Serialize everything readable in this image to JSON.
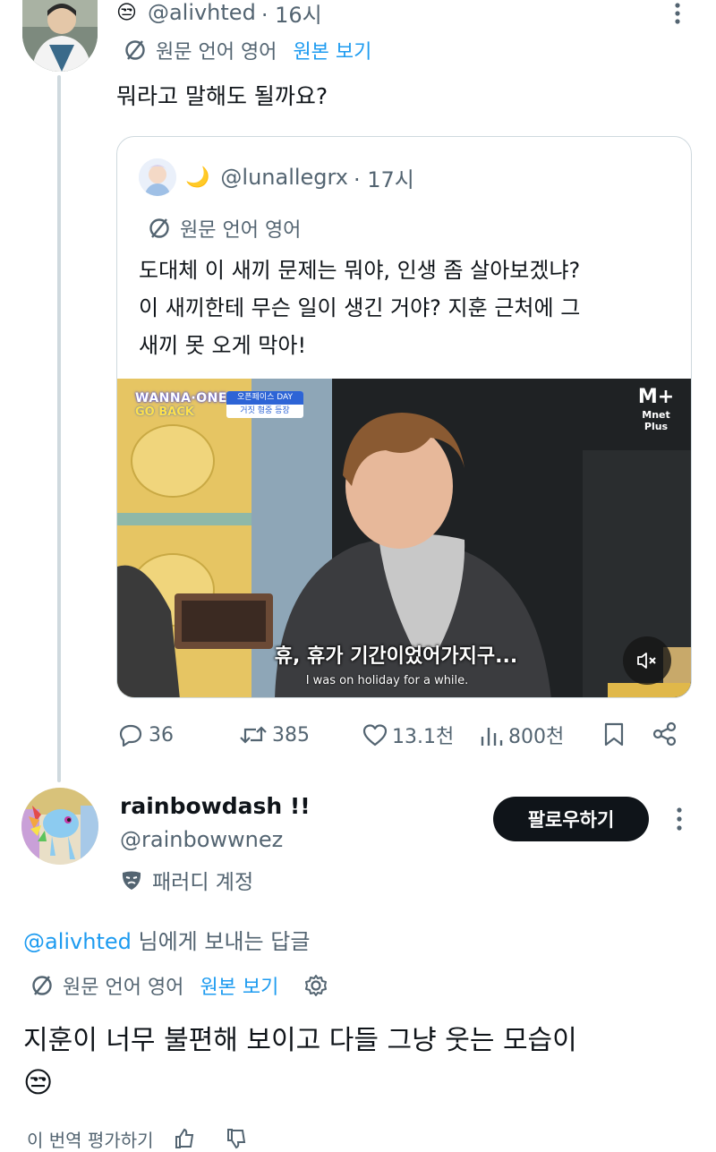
{
  "tweet1": {
    "emoji": "😒",
    "handle": "@alivhted",
    "time": "· 16시",
    "translate_label": "원문 언어 영어",
    "view_original": "원본 보기",
    "text": "뭐라고 말해도 될까요?",
    "quote": {
      "emoji": "🌙",
      "handle": "@lunallegrx",
      "time": "· 17시",
      "translate_label": "원문 언어 영어",
      "text_line1": "도대체 이 새끼 문제는 뭐야, 인생 좀 살아보겠냐?",
      "text_line2": "이 새끼한테 무슨 일이 생긴 거야? 지훈 근처에 그",
      "text_line3": "새끼 못 오게 막아!",
      "video": {
        "show_logo": "WANNA·ONE",
        "show_sub": "GO BACK",
        "badge_top": "오픈페이스 DAY",
        "badge_bottom": "거짓 형중 등장",
        "channel_logo": "M+",
        "channel_name": "Mnet Plus",
        "subtitle_kr": "휴, 휴가 기간이었어가지구...",
        "subtitle_en": "I was on holiday for a while."
      }
    },
    "stats": {
      "replies": "36",
      "retweets": "385",
      "likes": "13.1천",
      "views": "800천"
    }
  },
  "tweet2": {
    "name": "rainbowdash !!",
    "handle": "@rainbowwnez",
    "parody_label": "패러디 계정",
    "follow_label": "팔로우하기",
    "reply_to_handle": "@alivhted",
    "reply_to_suffix": " 님에게 보내는 답글",
    "translate_label": "원문 언어 영어",
    "view_original": "원본 보기",
    "text": "지훈이 너무 불편해 보이고 다들 그냥 웃는 모습이",
    "emoji": "😒",
    "footer_partial": "이 번역 평가하기"
  },
  "colors": {
    "accent": "#1d9bf0",
    "text": "#0f1419",
    "muted": "#536471",
    "border": "#cfd9de"
  }
}
